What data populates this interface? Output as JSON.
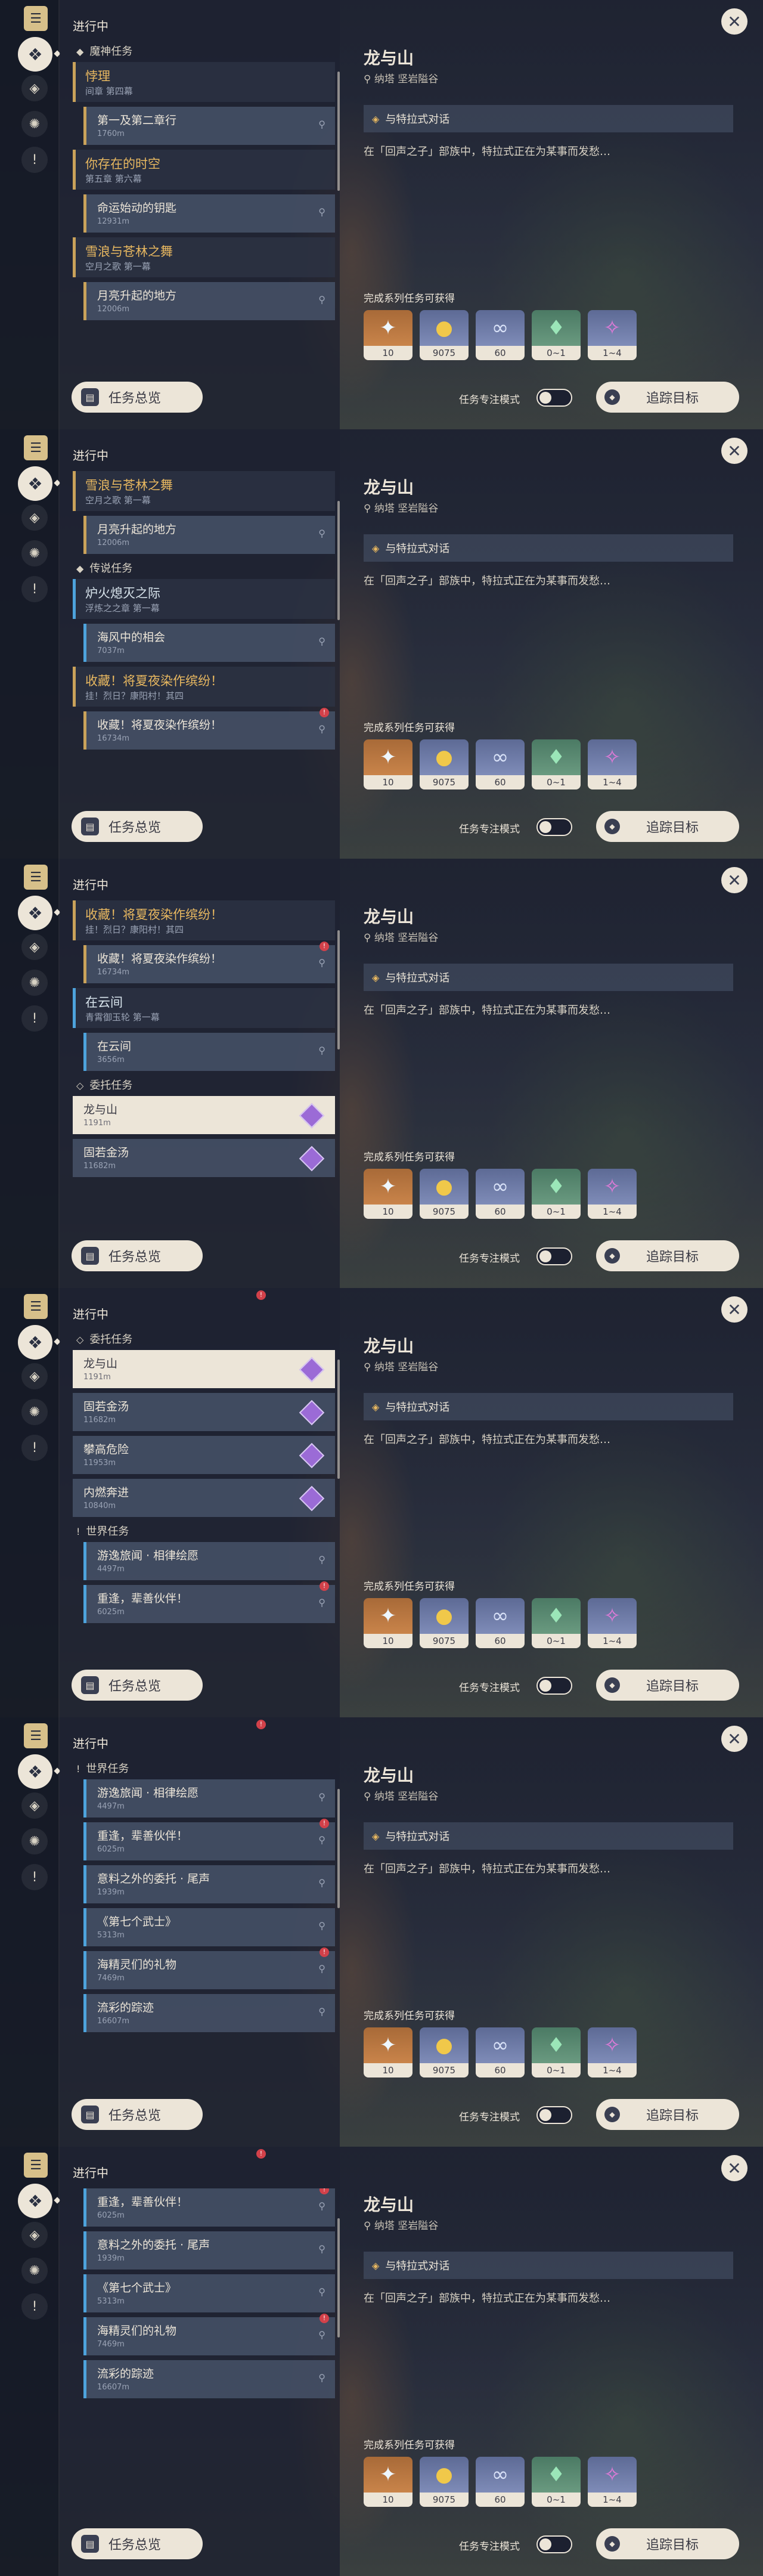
{
  "ui": {
    "in_progress": "进行中",
    "quest_overview": "任务总览",
    "focus_mode": "任务专注模式",
    "track": "追踪目标",
    "close": "✕"
  },
  "detail": {
    "title": "龙与山",
    "location": "纳塔 坚岩隘谷",
    "objective": "与特拉式对话",
    "description": "在「回声之子」部族中，特拉式正在为某事而发愁…",
    "rewards_label": "完成系列任务可获得",
    "rewards": [
      {
        "icon": "adventure-exp-icon",
        "glyph": "✦",
        "count": "10"
      },
      {
        "icon": "mora-icon",
        "glyph": "●",
        "count": "9075"
      },
      {
        "icon": "companionship-exp-icon",
        "glyph": "∞",
        "count": "60"
      },
      {
        "icon": "material-icon",
        "glyph": "♦",
        "count": "0~1"
      },
      {
        "icon": "crystal-icon",
        "glyph": "✧",
        "count": "1~4"
      }
    ]
  },
  "rail": [
    "quest-log-icon",
    "archon-quest-icon",
    "story-quest-icon",
    "world-quest-icon",
    "commission-icon"
  ],
  "frames": [
    {
      "scroll_top": 0,
      "items": [
        {
          "type": "section",
          "icon": "◆",
          "label": "魔神任务"
        },
        {
          "type": "group",
          "color": "gold",
          "title": "悖理",
          "sub": "间章 第四幕"
        },
        {
          "type": "row",
          "color": "gold",
          "title": "第一及第二章行",
          "dist": "1760m",
          "alert": false
        },
        {
          "type": "group",
          "color": "gold",
          "title": "你存在的时空",
          "sub": "第五章 第六幕"
        },
        {
          "type": "row",
          "color": "gold",
          "title": "命运始动的钥匙",
          "dist": "12931m",
          "alert": false
        },
        {
          "type": "group",
          "color": "gold",
          "title": "雪浪与苍林之舞",
          "sub": "空月之歌 第一幕"
        },
        {
          "type": "row",
          "color": "gold",
          "title": "月亮升起的地方",
          "dist": "12006m",
          "alert": false
        }
      ]
    },
    {
      "scroll_top": 0,
      "items": [
        {
          "type": "group",
          "color": "gold",
          "title": "雪浪与苍林之舞",
          "sub": "空月之歌 第一幕"
        },
        {
          "type": "row",
          "color": "gold",
          "title": "月亮升起的地方",
          "dist": "12006m",
          "alert": false
        },
        {
          "type": "section",
          "icon": "◆",
          "label": "传说任务"
        },
        {
          "type": "group",
          "color": "blue",
          "title": "炉火熄灭之际",
          "sub": "浮炼之之章 第一幕"
        },
        {
          "type": "row",
          "color": "blue",
          "title": "海风中的相会",
          "dist": "7037m",
          "alert": false
        },
        {
          "type": "group",
          "color": "gold",
          "title": "收藏！将夏夜染作缤纷！",
          "sub": "挂！烈日？康阳村！其四"
        },
        {
          "type": "row",
          "color": "gold",
          "title": "收藏！将夏夜染作缤纷！",
          "dist": "16734m",
          "alert": true
        }
      ]
    },
    {
      "scroll_top": 0,
      "items": [
        {
          "type": "group",
          "color": "gold",
          "title": "收藏！将夏夜染作缤纷！",
          "sub": "挂！烈日？康阳村！其四"
        },
        {
          "type": "row",
          "color": "gold",
          "title": "收藏！将夏夜染作缤纷！",
          "dist": "16734m",
          "alert": true
        },
        {
          "type": "group",
          "color": "blue",
          "title": "在云间",
          "sub": "青霄御玉轮 第一幕"
        },
        {
          "type": "row",
          "color": "blue",
          "title": "在云间",
          "dist": "3656m",
          "alert": false
        },
        {
          "type": "section",
          "icon": "◇",
          "label": "委托任务"
        },
        {
          "type": "commission",
          "title": "龙与山",
          "dist": "1191m",
          "selected": true
        },
        {
          "type": "commission",
          "title": "固若金汤",
          "dist": "11682m",
          "selected": false
        }
      ]
    },
    {
      "scroll_top": 0,
      "items": [
        {
          "type": "section",
          "icon": "◇",
          "label": "委托任务"
        },
        {
          "type": "commission",
          "title": "龙与山",
          "dist": "1191m",
          "selected": true
        },
        {
          "type": "commission",
          "title": "固若金汤",
          "dist": "11682m",
          "selected": false
        },
        {
          "type": "commission",
          "title": "攀高危险",
          "dist": "11953m",
          "selected": false
        },
        {
          "type": "commission",
          "title": "内燃奔进",
          "dist": "10840m",
          "selected": false
        },
        {
          "type": "section",
          "icon": "!",
          "label": "世界任务"
        },
        {
          "type": "row",
          "color": "blue",
          "title": "游逸旅闻 · 相律绘愿",
          "dist": "4497m",
          "alert": false
        },
        {
          "type": "row",
          "color": "blue",
          "title": "重逢，辈善伙伴！",
          "dist": "6025m",
          "alert": true
        }
      ]
    },
    {
      "scroll_top": 0,
      "items": [
        {
          "type": "section",
          "icon": "!",
          "label": "世界任务"
        },
        {
          "type": "row",
          "color": "blue",
          "title": "游逸旅闻 · 相律绘愿",
          "dist": "4497m",
          "alert": false
        },
        {
          "type": "row",
          "color": "blue",
          "title": "重逢，辈善伙伴！",
          "dist": "6025m",
          "alert": true
        },
        {
          "type": "row",
          "color": "blue",
          "title": "意料之外的委托 · 尾声",
          "dist": "1939m",
          "alert": false
        },
        {
          "type": "row",
          "color": "blue",
          "title": "《第七个武士》",
          "dist": "5313m",
          "alert": false
        },
        {
          "type": "row",
          "color": "blue",
          "title": "海精灵们的礼物",
          "dist": "7469m",
          "alert": true
        },
        {
          "type": "row",
          "color": "blue",
          "title": "流彩的踪迹",
          "dist": "16607m",
          "alert": false
        }
      ]
    },
    {
      "scroll_top": 0,
      "items": [
        {
          "type": "row",
          "color": "blue",
          "title": "重逢，辈善伙伴！",
          "dist": "6025m",
          "alert": true
        },
        {
          "type": "row",
          "color": "blue",
          "title": "意料之外的委托 · 尾声",
          "dist": "1939m",
          "alert": false
        },
        {
          "type": "row",
          "color": "blue",
          "title": "《第七个武士》",
          "dist": "5313m",
          "alert": false
        },
        {
          "type": "row",
          "color": "blue",
          "title": "海精灵们的礼物",
          "dist": "7469m",
          "alert": true
        },
        {
          "type": "row",
          "color": "blue",
          "title": "流彩的踪迹",
          "dist": "16607m",
          "alert": false
        }
      ]
    }
  ]
}
